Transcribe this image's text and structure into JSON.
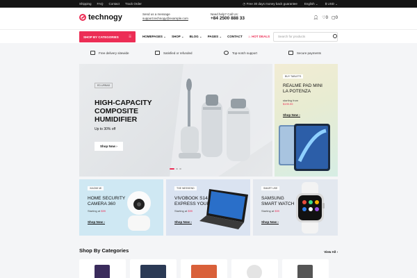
{
  "topbar": {
    "links": [
      "Shipping",
      "FAQ",
      "Contact",
      "Track Order"
    ],
    "promo": "Free 30 days money back guarantee",
    "language": "English",
    "currency": "$ USD"
  },
  "header": {
    "logo": "technogy",
    "message_label": "Send us a message",
    "email": "support.technogy@example.com",
    "help_label": "Need help? Call Us:",
    "phone": "+84 2500 888 33",
    "wishlist_count": "0",
    "cart_count": "0"
  },
  "nav": {
    "categories_button": "SHOP BY CATEGORIES",
    "items": [
      "HOMEPAGES",
      "SHOP",
      "BLOG",
      "PAGES",
      "CONTACT"
    ],
    "hot_deals": "HOT DEALS",
    "search_placeholder": "Search for products"
  },
  "features": [
    "Free delivery sitewide",
    "Satisfied or refunded",
    "Top-notch support",
    "Secure payments"
  ],
  "hero": {
    "badge": "ED-URBAD",
    "title_lines": [
      "HIGH-CAPACITY",
      "COMPOSITE",
      "HUMIDIFIER"
    ],
    "subtitle": "Up to 30% off",
    "button": "Shop Now"
  },
  "tablet_promo": {
    "badge": "BUY TABLETS",
    "title_lines": [
      "REALME PAD MINI",
      "LA POTENZA"
    ],
    "starting_label": "starting from",
    "price": "$199.99",
    "link": "Shop Now"
  },
  "promo_cards": [
    {
      "badge": "XIAOMI MI",
      "title_lines": [
        "HOME SECURITY",
        "CAMERA 360"
      ],
      "starting_label": "Starting at",
      "price": "$99",
      "link": "Shop Now"
    },
    {
      "badge": "THE WEEKEND",
      "title_lines": [
        "VIVOBOOK S14",
        "EXPRESS YOURSELF"
      ],
      "starting_label": "Starting at",
      "price": "$99",
      "link": "Shop Now"
    },
    {
      "badge": "SMART USE",
      "title_lines": [
        "SAMSUNG",
        "SMART WATCH"
      ],
      "starting_label": "Starting at",
      "price": "$99",
      "link": "Shop Now"
    }
  ],
  "categories": {
    "title": "Shop By Categories",
    "view_all": "View All"
  },
  "colors": {
    "accent": "#ec2d55",
    "topbar": "#151515"
  }
}
